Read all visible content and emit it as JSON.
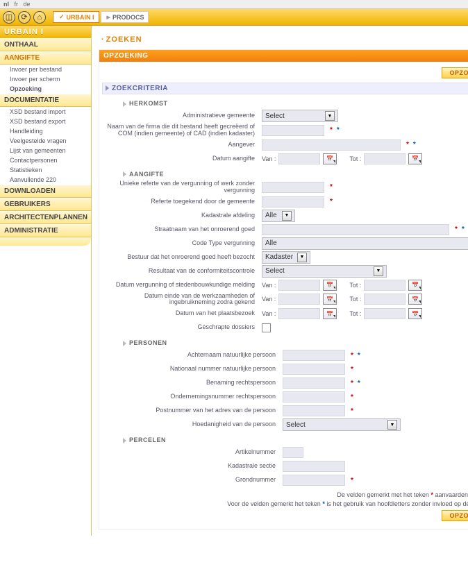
{
  "topbar": {
    "langs": [
      "nl",
      "fr",
      "de"
    ],
    "active": "nl"
  },
  "app": {
    "name": "URBAIN I"
  },
  "breadcrumb": [
    "URBAIN I",
    "PRODOCS"
  ],
  "sidebar": {
    "sections": [
      {
        "label": "ONTHAAL",
        "items": []
      },
      {
        "label": "AANGIFTE",
        "selected": true,
        "items": [
          {
            "label": "Invoer per bestand"
          },
          {
            "label": "Invoer per scherm"
          },
          {
            "label": "Opzoeking",
            "bold": true
          }
        ]
      },
      {
        "label": "DOCUMENTATIE",
        "items": [
          {
            "label": "XSD bestand import"
          },
          {
            "label": "XSD bestand export"
          },
          {
            "label": "Handleiding"
          },
          {
            "label": "Veelgestelde vragen"
          },
          {
            "label": "Lijst van gemeenten"
          },
          {
            "label": "Contactpersonen"
          },
          {
            "label": "Statistieken"
          },
          {
            "label": "Aanvullende 220"
          }
        ]
      },
      {
        "label": "DOWNLOADEN",
        "items": []
      },
      {
        "label": "GEBRUIKERS",
        "items": []
      },
      {
        "label": "ARCHITECTENPLANNEN",
        "items": []
      },
      {
        "label": "ADMINISTRATIE",
        "items": []
      }
    ]
  },
  "page": {
    "title": "ZOEKEN"
  },
  "panel": {
    "header": "OPZOEKING",
    "search_btn": "OPZOEKEN"
  },
  "criteria": {
    "title": "ZOEKCRITERIA",
    "herkomst": {
      "title": "HERKOMST",
      "admin_gemeente": {
        "label": "Administratieve gemeente",
        "value": "Select"
      },
      "firma": {
        "label": "Naam van de firma die dit bestand heeft gecreëerd of COM (indien gemeente) of CAD (indien kadaster)"
      },
      "aangever": {
        "label": "Aangever"
      },
      "datum_aangifte": {
        "label": "Datum aangifte",
        "van": "Van :",
        "tot": "Tot :"
      }
    },
    "aangifte": {
      "title": "AANGIFTE",
      "unieke_ref": {
        "label": "Unieke referte van de vergunning of werk zonder vergunning"
      },
      "ref_gemeente": {
        "label": "Referte toegekend door de gemeente"
      },
      "kad_afdeling": {
        "label": "Kadastrale afdeling",
        "value": "Alle"
      },
      "straatnaam": {
        "label": "Straatnaam van het onroerend goed"
      },
      "code_type": {
        "label": "Code Type vergunning",
        "value": "Alle"
      },
      "bestuur": {
        "label": "Bestuur dat het onroerend goed heeft bezocht",
        "value": "Kadaster"
      },
      "resultaat": {
        "label": "Resultaat van de conformiteitscontrole",
        "value": "Select"
      },
      "datum_vergunning": {
        "label": "Datum vergunning of stedenbouwkundige melding",
        "van": "Van :",
        "tot": "Tot :"
      },
      "datum_einde": {
        "label": "Datum einde van de werkzaamheden of ingebruikneming zodra gekend",
        "van": "Van :",
        "tot": "Tot :"
      },
      "datum_plaats": {
        "label": "Datum van het plaatsbezoek",
        "van": "Van :",
        "tot": "Tot :"
      },
      "geschrapte": {
        "label": "Geschrapte dossiers"
      }
    },
    "personen": {
      "title": "PERSONEN",
      "achternaam": {
        "label": "Achternaam natuurlijke persoon"
      },
      "nationaal": {
        "label": "Nationaal nummer natuurlijke persoon"
      },
      "benaming": {
        "label": "Benaming rechtspersoon"
      },
      "ondernemings": {
        "label": "Ondernemingsnummer rechtspersoon"
      },
      "postnummer": {
        "label": "Postnummer van het adres van de persoon"
      },
      "hoedanigheid": {
        "label": "Hoedanigheid van de persoon",
        "value": "Select"
      }
    },
    "percelen": {
      "title": "PERCELEN",
      "artikel": {
        "label": "Artikelnummer"
      },
      "sectie": {
        "label": "Kadastrale sectie"
      },
      "grond": {
        "label": "Grondnummer"
      }
    }
  },
  "footer": {
    "line1a": "De velden gemerkt met het teken ",
    "line1b": " aanvaarden jokers (%)",
    "line2a": "Voor de velden gemerkt het teken ",
    "line2b": " is het gebruik van hoofdletters zonder invloed op de zoekactie",
    "btn": "OPZOEKEN"
  }
}
